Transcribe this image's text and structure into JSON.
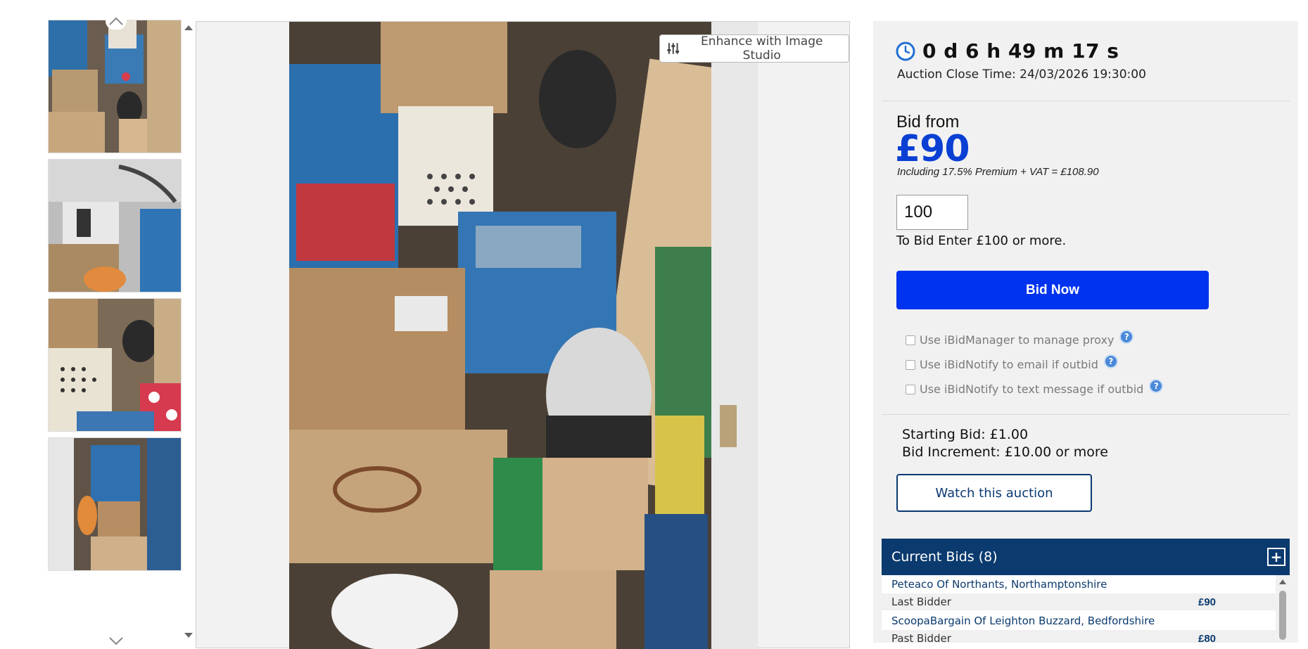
{
  "gallery": {
    "enhance_label": "Enhance with Image Studio",
    "thumbnails": [
      "thumb-1",
      "thumb-2",
      "thumb-3",
      "thumb-4"
    ]
  },
  "auction": {
    "countdown": "0 d 6 h 49 m 17 s",
    "close_time": "Auction Close Time: 24/03/2026 19:30:00"
  },
  "bidding": {
    "bid_from_label": "Bid from",
    "bid_from_price": "£90",
    "premium_note": "Including 17.5% Premium + VAT = £108.90",
    "bid_input_value": "100",
    "bid_hint": "To Bid Enter £100 or more.",
    "bid_now_label": "Bid Now",
    "options": [
      "Use iBidManager to manage proxy",
      "Use iBidNotify to email if outbid",
      "Use iBidNotify to text message if outbid"
    ],
    "help_symbol": "?",
    "starting_bid": "Starting Bid: £1.00",
    "bid_increment": "Bid Increment: £10.00 or more",
    "watch_label": "Watch this auction"
  },
  "current_bids": {
    "title": "Current Bids (8)",
    "expand_symbol": "+",
    "entries": [
      {
        "bidder": "Peteaco Of Northants, Northamptonshire",
        "role": "Last Bidder",
        "amount": "£90"
      },
      {
        "bidder": "ScoopaBargain Of Leighton Buzzard, Bedfordshire",
        "role": "Past Bidder",
        "amount": "£80"
      }
    ]
  },
  "colors": {
    "accent_blue": "#0033ee",
    "price_blue": "#0a3fd4",
    "navy": "#0b3a6e",
    "panel_bg": "#f1f1f1"
  },
  "icons": [
    "chevron-up-icon",
    "chevron-down-icon",
    "sliders-icon",
    "clock-icon",
    "help-icon",
    "plus-icon"
  ]
}
